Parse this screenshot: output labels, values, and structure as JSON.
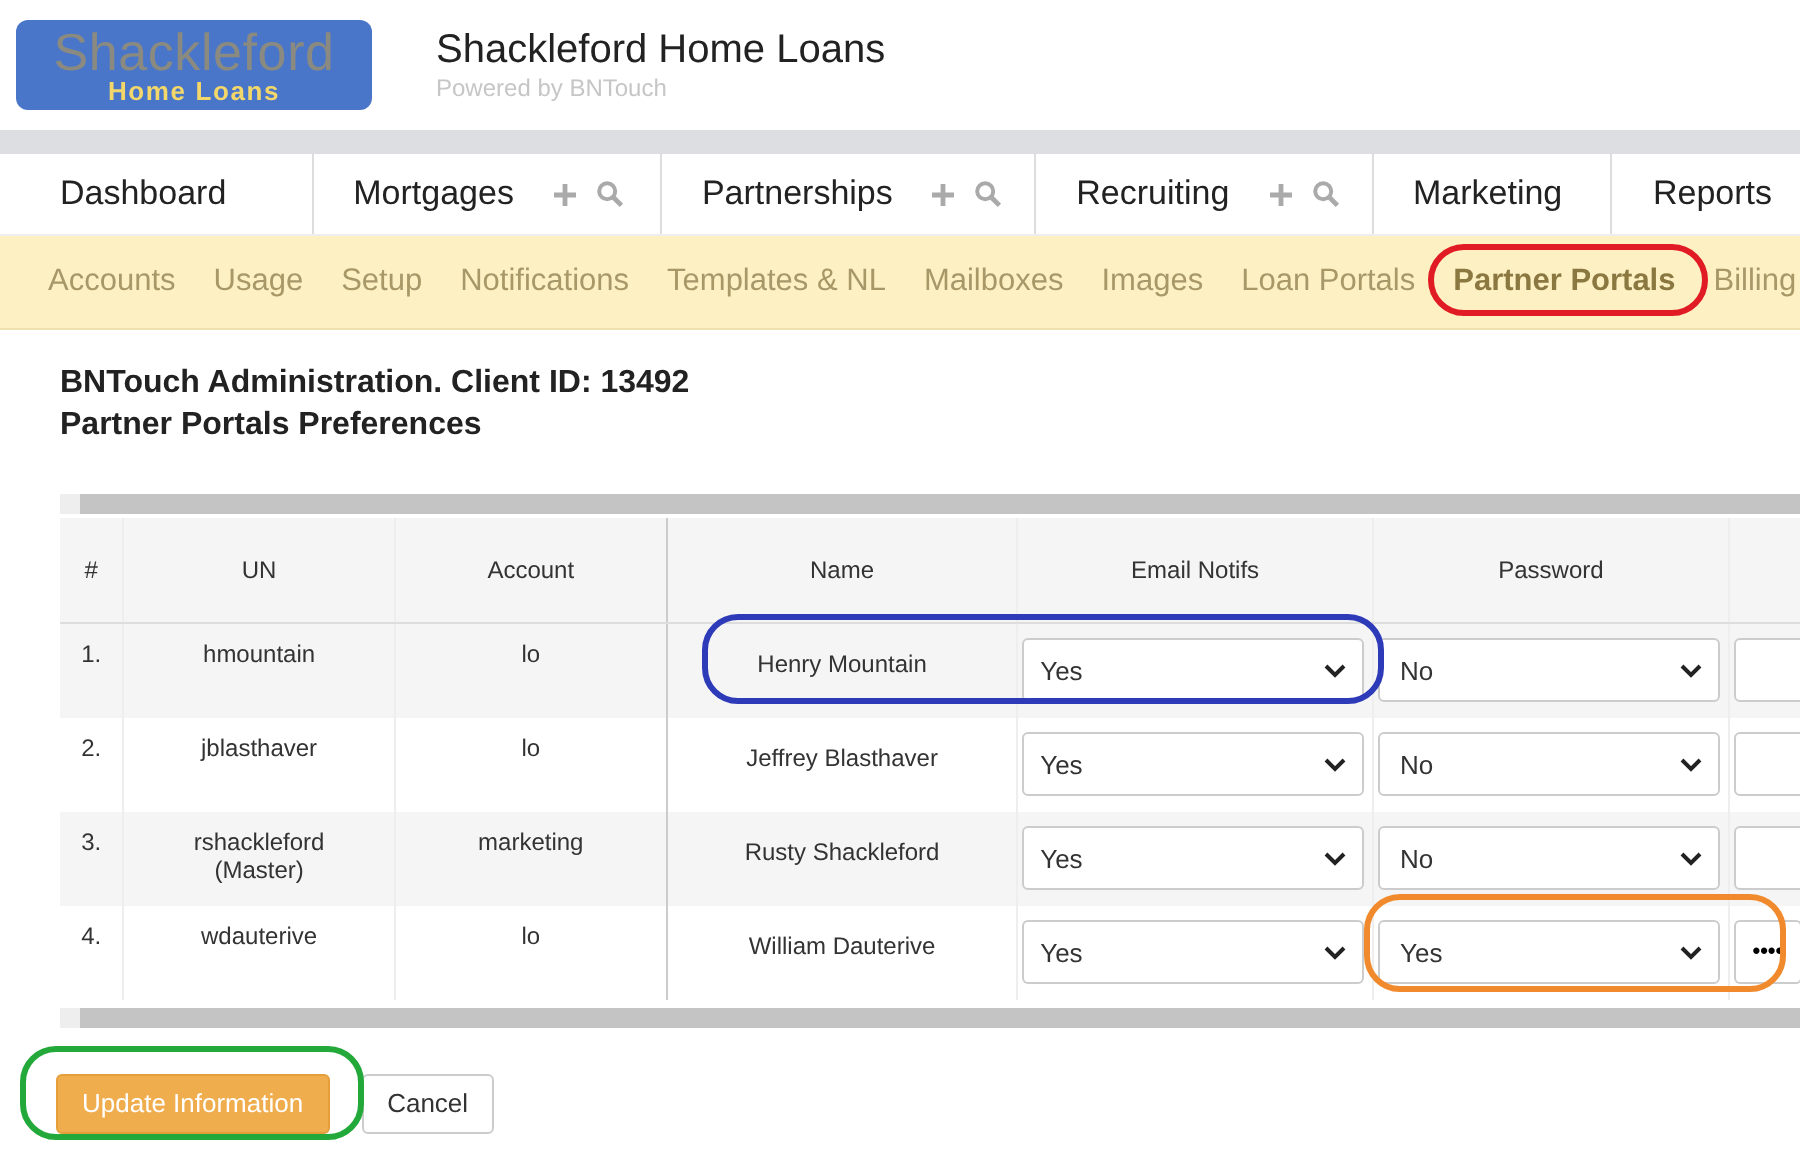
{
  "header": {
    "logo": {
      "line1": "Shackleford",
      "line2": "Home Loans"
    },
    "title": "Shackleford Home Loans",
    "subtitle": "Powered by BNTouch"
  },
  "main_nav": [
    {
      "label": "Dashboard",
      "has_actions": false
    },
    {
      "label": "Mortgages",
      "has_actions": true
    },
    {
      "label": "Partnerships",
      "has_actions": true
    },
    {
      "label": "Recruiting",
      "has_actions": true
    },
    {
      "label": "Marketing",
      "has_actions": false
    },
    {
      "label": "Reports",
      "has_actions": false
    }
  ],
  "sub_nav": [
    {
      "label": "Accounts",
      "selected": false
    },
    {
      "label": "Usage",
      "selected": false
    },
    {
      "label": "Setup",
      "selected": false
    },
    {
      "label": "Notifications",
      "selected": false
    },
    {
      "label": "Templates & NL",
      "selected": false
    },
    {
      "label": "Mailboxes",
      "selected": false
    },
    {
      "label": "Images",
      "selected": false
    },
    {
      "label": "Loan Portals",
      "selected": false
    },
    {
      "label": "Partner Portals",
      "selected": true
    },
    {
      "label": "Billing",
      "selected": false
    }
  ],
  "page_title": "BNTouch Administration. Client ID: 13492",
  "page_subtitle": "Partner Portals Preferences",
  "table": {
    "columns": [
      "#",
      "UN",
      "Account",
      "Name",
      "Email Notifs",
      "Password"
    ],
    "rows": [
      {
        "num": "1.",
        "un": "hmountain",
        "un_note": "",
        "account": "lo",
        "name": "Henry Mountain",
        "email_notifs": "Yes",
        "password": "No",
        "password_set": false
      },
      {
        "num": "2.",
        "un": "jblasthaver",
        "un_note": "",
        "account": "lo",
        "name": "Jeffrey Blasthaver",
        "email_notifs": "Yes",
        "password": "No",
        "password_set": false
      },
      {
        "num": "3.",
        "un": "rshackleford",
        "un_note": "(Master)",
        "account": "marketing",
        "name": "Rusty Shackleford",
        "email_notifs": "Yes",
        "password": "No",
        "password_set": false
      },
      {
        "num": "4.",
        "un": "wdauterive",
        "un_note": "",
        "account": "lo",
        "name": "William Dauterive",
        "email_notifs": "Yes",
        "password": "Yes",
        "password_set": true,
        "password_mask": "••••"
      }
    ]
  },
  "buttons": [
    {
      "label": "Update Information",
      "kind": "primary"
    },
    {
      "label": "Cancel",
      "kind": "secondary"
    }
  ],
  "annotations": [
    {
      "color": "#e01b24"
    },
    {
      "color": "#2e3bb8"
    },
    {
      "color": "#f08a2c"
    },
    {
      "color": "#23a83a"
    }
  ]
}
